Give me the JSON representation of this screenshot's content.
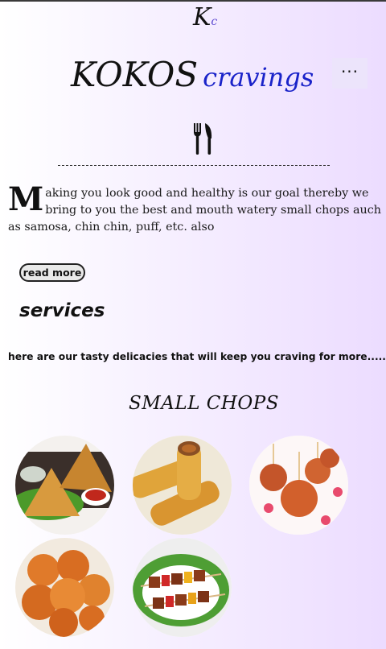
{
  "header": {
    "logo_mark": "K",
    "logo_mark_small": "c",
    "brand_primary": "KOKOS",
    "brand_secondary": "cravings",
    "menu_label": "···"
  },
  "icons": {
    "cutlery": "fork-knife-icon",
    "menu": "more-dots-icon"
  },
  "intro": {
    "dropcap": "M",
    "text": "aking you look good and healthy is our goal thereby we bring to you the best and mouth watery small chops auch as samosa, chin chin, puff, etc. also"
  },
  "actions": {
    "read_more_label": "read more"
  },
  "services": {
    "title": "services",
    "description": "here are our tasty delicacies that will keep you craving for more....."
  },
  "small_chops": {
    "title": "SMALL CHOPS",
    "items": [
      {
        "name": "samosa"
      },
      {
        "name": "spring rolls"
      },
      {
        "name": "meatballs"
      },
      {
        "name": "puff puff"
      },
      {
        "name": "kebab skewers"
      }
    ]
  },
  "colors": {
    "brand_accent": "#1a23c9",
    "background_end": "#ecdcff"
  }
}
